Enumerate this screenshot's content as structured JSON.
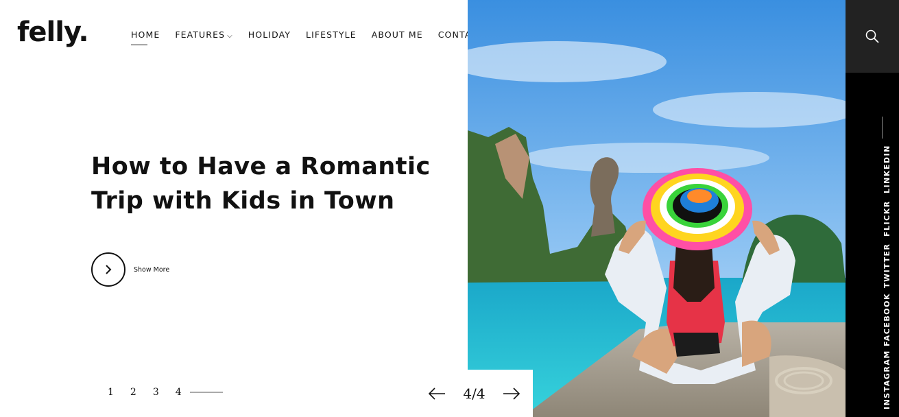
{
  "brand": {
    "logo": "felly."
  },
  "nav": {
    "items": [
      {
        "label": "HOME",
        "active": true
      },
      {
        "label": "FEATURES",
        "has_dropdown": true
      },
      {
        "label": "HOLIDAY"
      },
      {
        "label": "LIFESTYLE"
      },
      {
        "label": "ABOUT ME"
      },
      {
        "label": "CONTACT"
      }
    ]
  },
  "hero": {
    "title_line1": "How to Have a Romantic",
    "title_line2": "Trip with Kids in Town",
    "show_more_label": "Show More"
  },
  "pager": {
    "pages": [
      "1",
      "2",
      "3",
      "4"
    ],
    "current": "4"
  },
  "slider": {
    "counter": "4/4"
  },
  "social": {
    "links": [
      "LINKEDIN",
      "FLICKR",
      "TWITTER",
      "FACEBOOK",
      "INSTAGRAM"
    ]
  },
  "icons": {
    "search": "search-icon",
    "chevron": "chevron-right-icon",
    "prev": "arrow-left-icon",
    "next": "arrow-right-icon",
    "dropdown": "chevron-down-icon"
  },
  "colors": {
    "sidebar_bg": "#000000",
    "search_bg": "#222222",
    "text": "#111111"
  }
}
